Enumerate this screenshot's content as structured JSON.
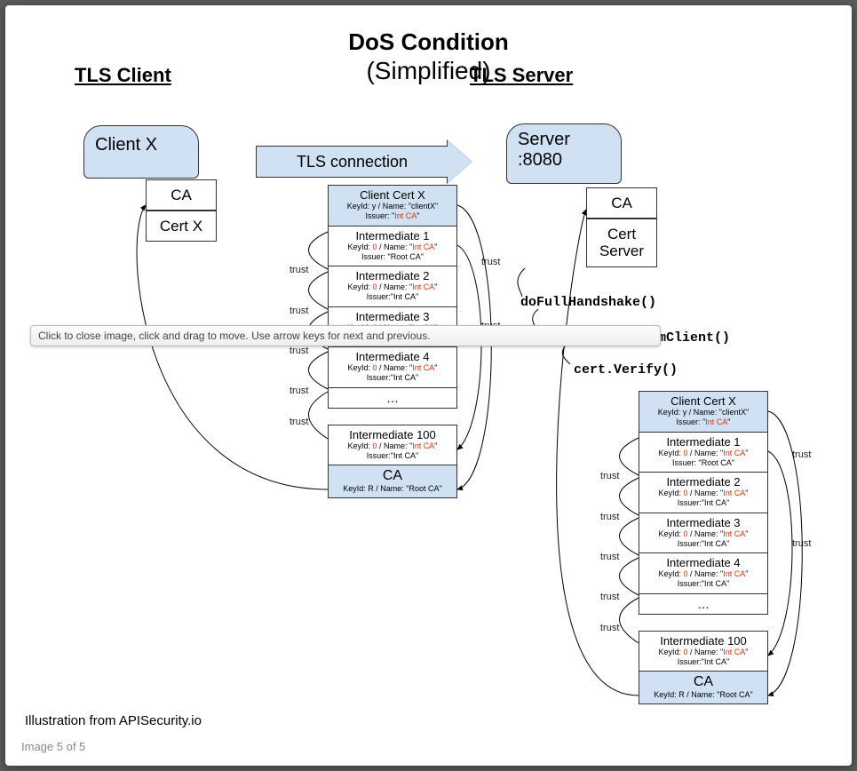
{
  "titles": {
    "main": "DoS Condition",
    "sub": "(Simplified)",
    "left": "TLS Client",
    "right": "TLS Server"
  },
  "client": {
    "label": "Client X",
    "ca": "CA",
    "cert": "Cert X"
  },
  "server": {
    "label_l1": "Server",
    "label_l2": ":8080",
    "ca": "CA",
    "cert_l1": "Cert",
    "cert_l2": "Server"
  },
  "tls_arrow": "TLS connection",
  "functions": {
    "f1": "doFullHandshake()",
    "f2": "processCertsFromClient()",
    "f3": "cert.Verify()"
  },
  "chain_template": {
    "client_cert": {
      "title": "Client Cert X",
      "l1a": "KeyId: y / Name: \"clientX\"",
      "l2": "Issuer: \"",
      "l2r": "Int CA",
      "l2e": "\""
    },
    "int1": {
      "title": "Intermediate 1",
      "l1a": "KeyId: ",
      "l1r": "0",
      "l1b": " / Name: \"",
      "l1n": "Int CA",
      "l1e": "\"",
      "l2": "Issuer: \"Root CA\""
    },
    "int2": {
      "title": "Intermediate 2",
      "l2": "Issuer:\"Int CA\""
    },
    "int3": {
      "title": "Intermediate 3",
      "l2": "Issuer:\"Int CA\""
    },
    "int4": {
      "title": "Intermediate 4",
      "l2": "Issuer:\"Int CA\""
    },
    "ell": "…",
    "int100": {
      "title": "Intermediate 100",
      "l2": "Issuer:\"Int CA\""
    },
    "ca": {
      "title": "CA",
      "l1": "KeyId: R / Name: \"Root CA\""
    }
  },
  "trust_label": "trust",
  "tooltip": "Click to close image, click and drag to move. Use arrow keys for next and previous.",
  "attribution": "Illustration from APISecurity.io",
  "counter": "Image 5 of 5"
}
